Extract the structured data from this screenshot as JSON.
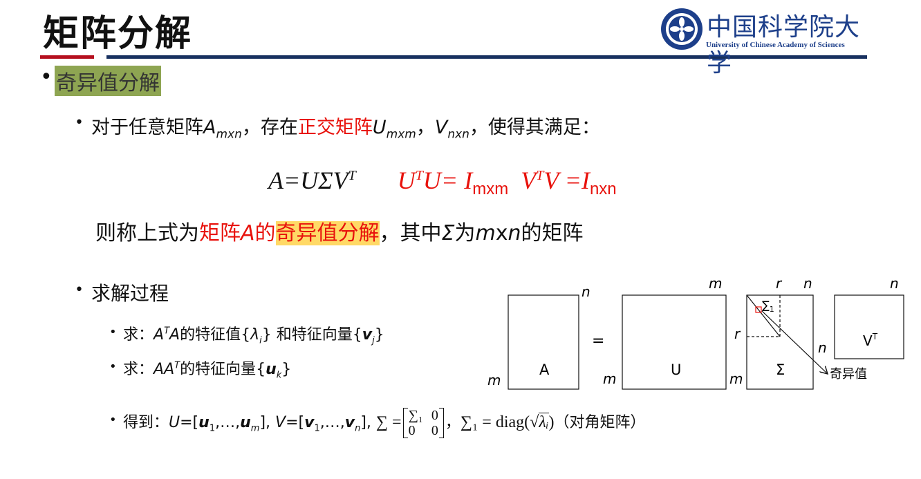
{
  "slide": {
    "title": "矩阵分解",
    "colors": {
      "red_bar": "#b50f1e",
      "navy_bar": "#17305f",
      "highlight_green": "#8ea552",
      "highlight_yellow": "#ffd966",
      "accent_red": "#e8120c",
      "logo_blue": "#1d3f8a"
    }
  },
  "logo": {
    "cn_name": "中国科学院大学",
    "en_name": "University of Chinese Academy of Sciences",
    "icon": "ucas-emblem-icon"
  },
  "bullet1": {
    "text": "奇异值分解"
  },
  "bullet2": {
    "p1": "对于任意矩阵",
    "A": "A",
    "A_sub": "mxn",
    "p2": "，存在",
    "red": "正交矩阵",
    "U": "U",
    "U_sub": "mxm",
    "p3": "，",
    "V": "V",
    "V_sub": "nxn",
    "p4": "，使得其满足："
  },
  "equation": {
    "lhs": "A=UΣV",
    "lhs_sup": "T",
    "r1_a": "U",
    "r1_sup": "T",
    "r1_b": "U= I",
    "r1_sub": "mxm",
    "r2_a": "V",
    "r2_sup": "T",
    "r2_b": "V =I",
    "r2_sub": "nxn"
  },
  "then_line": {
    "p1": "则称上式为",
    "red1": "矩阵",
    "redA": "A",
    "red2": "的",
    "highlight": "奇异值分解",
    "p2": "，其中",
    "sigma": "Σ",
    "p3": "为",
    "m": "m",
    "x": "x",
    "n": "n",
    "p4": "的矩阵"
  },
  "bullet3": {
    "text": "求解过程"
  },
  "sub1": {
    "p1": "求：",
    "A1": "A",
    "sup": "T",
    "A2": "A",
    "p2": "的特征值{",
    "lambda": "λ",
    "lambda_sub": "i",
    "p3": "} 和特征向量{",
    "v": "v",
    "v_sub": "j",
    "p4": "}"
  },
  "sub2": {
    "p1": "求：",
    "AA": "AA",
    "sup": "T",
    "p2": "的特征向量{",
    "u": "u",
    "u_sub": "k",
    "p3": "}"
  },
  "sub3": {
    "p1": "得到：",
    "U": "U",
    "eq1": "=[",
    "u1": "u",
    "u1_sub": "1",
    "dots1": ",…,",
    "um": "u",
    "um_sub": "m",
    "close1": "], ",
    "V": "V",
    "eq2": "=[",
    "v1": "v",
    "v1_sub": "1",
    "dots2": ",…,",
    "vn": "v",
    "vn_sub": "n",
    "close2": "], ",
    "sum_eq": "∑ =",
    "m11": "∑₁",
    "m12": "0",
    "m21": "0",
    "m22": "0",
    "after": "，",
    "sum1_eq": "∑₁ = diag(",
    "sqrt": "√",
    "lam": "λᵢ",
    "close": ")",
    "note": "（对角矩阵）"
  },
  "diagram": {
    "A_label": "A",
    "U_label": "U",
    "S_label": "Σ",
    "V_label": "V",
    "V_sup": "T",
    "eq": "=",
    "m": "m",
    "n": "n",
    "r": "r",
    "sigma1": "∑",
    "sigma1_sub": "1",
    "singular_values": "奇异值"
  }
}
